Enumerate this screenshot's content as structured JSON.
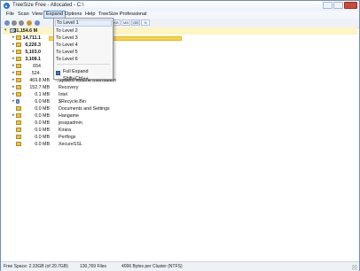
{
  "window": {
    "title": "TreeSize Free - Allocated - C:\\"
  },
  "menu": [
    {
      "label": "File"
    },
    {
      "label": "Scan"
    },
    {
      "label": "View"
    },
    {
      "label": "Expand"
    },
    {
      "label": "Options"
    },
    {
      "label": "Help"
    },
    {
      "label": "TreeSize Professional"
    }
  ],
  "toolbar": {
    "buttons": [
      "KB",
      "MB",
      "GB",
      "%"
    ]
  },
  "dropdown": {
    "items": [
      "To Level 1",
      "To Level 2",
      "To Level 3",
      "To Level 4",
      "To Level 5",
      "To Level 6"
    ],
    "full_expand": "Full Expand  Shift+Ctrl++"
  },
  "tree": {
    "root_size": "31,154.6 M",
    "rows": [
      {
        "size": "14,711.1",
        "name": ""
      },
      {
        "size": "6,226.3",
        "name": ""
      },
      {
        "size": "5,103.0",
        "name": ""
      },
      {
        "size": "3,108.1",
        "name": ""
      },
      {
        "size": "654",
        "name": ""
      },
      {
        "size": "524.",
        "name": ""
      },
      {
        "size": "469.8 MB",
        "name": "System Volume Information"
      },
      {
        "size": "152.7 MB",
        "name": "Recovery"
      },
      {
        "size": "0.1 MB",
        "name": "Intel"
      },
      {
        "size": "0.0 MB",
        "name": "$Recycle.Bin"
      },
      {
        "size": "0.0 MB",
        "name": "Documents and Settings"
      },
      {
        "size": "0.0 MB",
        "name": "Hangame"
      },
      {
        "size": "0.0 MB",
        "name": "jesspadmin"
      },
      {
        "size": "0.0 MB",
        "name": "Kirara"
      },
      {
        "size": "0.0 MB",
        "name": "Perflogs"
      },
      {
        "size": "0.0 MB",
        "name": "XecureSSL"
      }
    ]
  },
  "status": {
    "free_space": "Free Space: 2.33GB   (of 29.7GB)",
    "files": "130,769  Files",
    "cluster": "4096 Bytes per Cluster (NTFS)"
  }
}
